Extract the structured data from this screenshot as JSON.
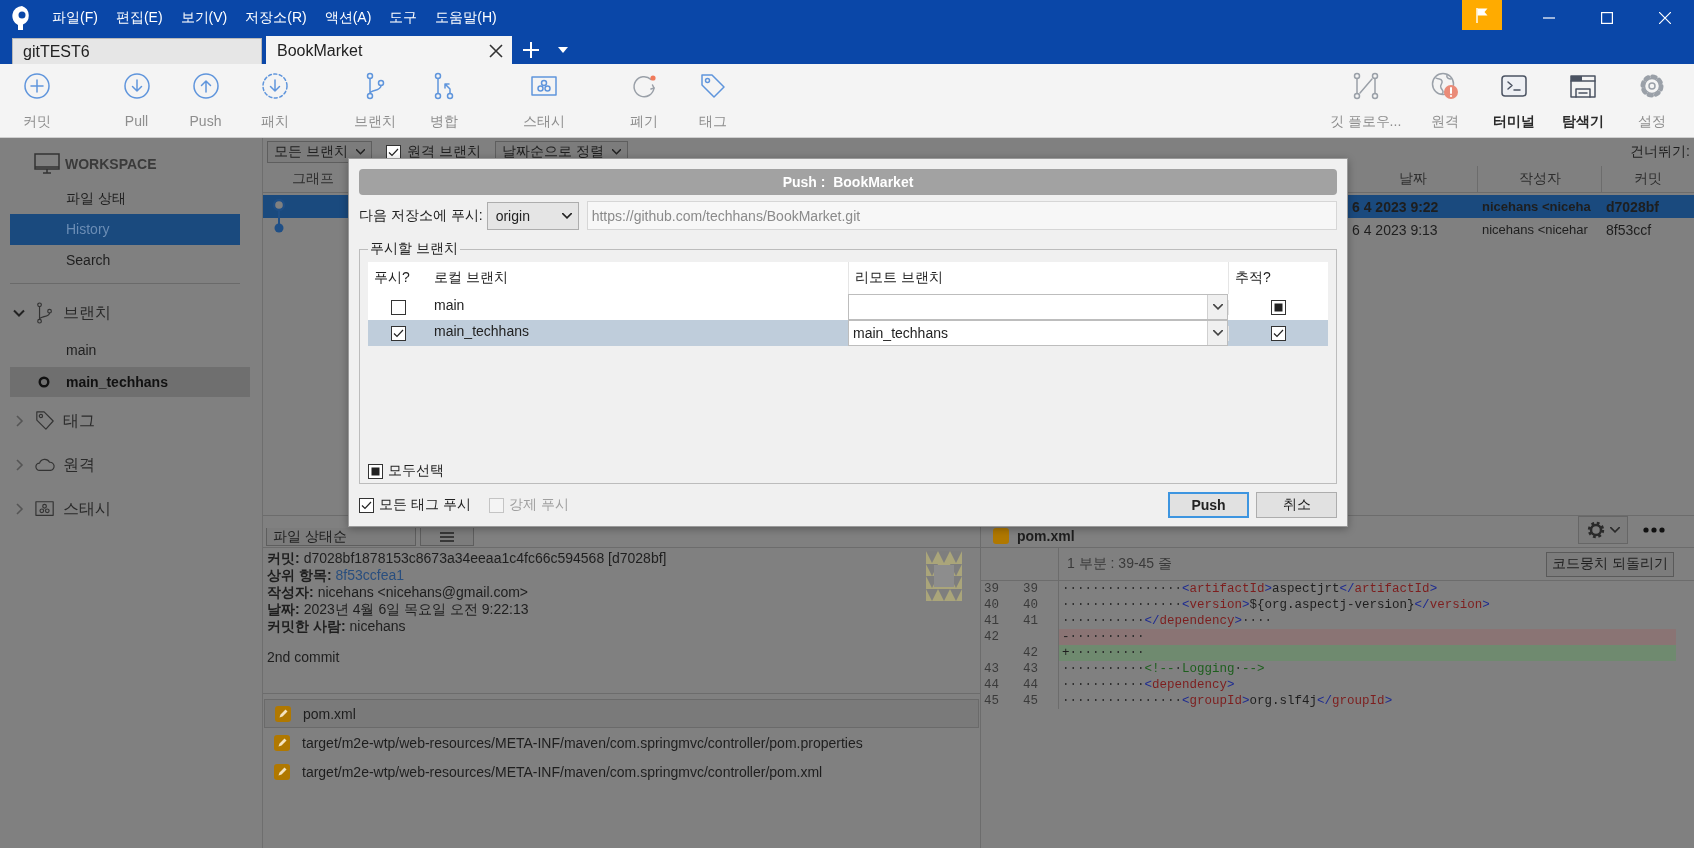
{
  "title_bar": {
    "menu": [
      "파일(F)",
      "편집(E)",
      "보기(V)",
      "저장소(R)",
      "액션(A)",
      "도구",
      "도움말(H)"
    ]
  },
  "tabs": [
    {
      "label": "gitTEST6",
      "selected": false
    },
    {
      "label": "BookMarket",
      "selected": true
    }
  ],
  "toolbar": {
    "left": [
      [
        {
          "label": "커밋",
          "strong": false
        }
      ],
      [
        {
          "label": "Pull",
          "strong": false
        },
        {
          "label": "Push",
          "strong": false
        },
        {
          "label": "패치",
          "strong": false
        }
      ],
      [
        {
          "label": "브랜치",
          "strong": false
        },
        {
          "label": "병합",
          "strong": false
        }
      ],
      [
        {
          "label": "스태시",
          "strong": false
        }
      ],
      [
        {
          "label": "폐기",
          "strong": false
        },
        {
          "label": "태그",
          "strong": false
        }
      ]
    ],
    "right": [
      [
        {
          "label": "깃 플로우...",
          "strong": false
        }
      ],
      [
        {
          "label": "원격",
          "strong": false
        },
        {
          "label": "터미널",
          "strong": true
        },
        {
          "label": "탐색기",
          "strong": true
        },
        {
          "label": "설정",
          "strong": false
        }
      ]
    ]
  },
  "sidebar": {
    "workspace": {
      "label": "WORKSPACE",
      "items": [
        {
          "label": "파일 상태",
          "selected": false
        },
        {
          "label": "History",
          "selected": true
        },
        {
          "label": "Search",
          "selected": false
        }
      ]
    },
    "sections": [
      {
        "label": "브랜치",
        "expanded": true,
        "children": [
          {
            "label": "main",
            "current": false
          },
          {
            "label": "main_techhans",
            "current": true
          }
        ]
      },
      {
        "label": "태그",
        "expanded": false
      },
      {
        "label": "원격",
        "expanded": false
      },
      {
        "label": "스태시",
        "expanded": false
      }
    ]
  },
  "history": {
    "filters": [
      {
        "kind": "dropdown",
        "label": "모든 브랜치"
      },
      {
        "kind": "checkbox",
        "label": "원격 브랜치",
        "checked": true
      },
      {
        "kind": "dropdown",
        "label": "날짜순으로 정렬"
      }
    ],
    "jump_label": "건너뛰기:",
    "columns": [
      "그래프",
      "날짜",
      "작성자",
      "커밋"
    ],
    "rows": [
      {
        "date": "6 4 2023 9:22",
        "author": "nicehans <niceha",
        "commit": "d7028bf",
        "selected": true
      },
      {
        "date": "6 4 2023 9:13",
        "author": "nicehans <nicehar",
        "commit": "8f53ccf",
        "selected": false
      }
    ]
  },
  "details": {
    "sort": "파일 상태순",
    "fields": [
      {
        "label": "커밋:",
        "value": "d7028bf1878153c8673a34eeaa1c4fc66c594568 [d7028bf]",
        "kind": "text"
      },
      {
        "label": "상위 항목:",
        "value": "8f53ccfea1",
        "kind": "link"
      },
      {
        "label": "작성자:",
        "value": "nicehans <nicehans@gmail.com>",
        "kind": "text"
      },
      {
        "label": "날짜:",
        "value": "2023년 4월 6일 목요일 오전 9:22:13",
        "kind": "text"
      },
      {
        "label": "커밋한 사람:",
        "value": "nicehans",
        "kind": "text"
      }
    ],
    "message": "2nd commit",
    "files": [
      {
        "path": "pom.xml",
        "selected": true
      },
      {
        "path": "target/m2e-wtp/web-resources/META-INF/maven/com.springmvc/controller/pom.properties",
        "selected": false
      },
      {
        "path": "target/m2e-wtp/web-resources/META-INF/maven/com.springmvc/controller/pom.xml",
        "selected": false
      }
    ]
  },
  "diff": {
    "file": "pom.xml",
    "hunk_title": "1 부분 : 39-45 줄",
    "revert_button": "코드뭉치 되돌리기",
    "lines": [
      {
        "old": "39",
        "new": "39",
        "kind": "context",
        "code": "················<artifactId>aspectjrt</artifactId>"
      },
      {
        "old": "40",
        "new": "40",
        "kind": "context",
        "code": "················<version>${org.aspectj-version}</version>"
      },
      {
        "old": "41",
        "new": "41",
        "kind": "context",
        "code": "···········</dependency>····"
      },
      {
        "old": "42",
        "kind": "removed",
        "code": "-··········"
      },
      {
        "new": "42",
        "kind": "added",
        "code": "+··········"
      },
      {
        "old": "43",
        "new": "43",
        "kind": "context",
        "code": "···········<!--·Logging·-->"
      },
      {
        "old": "44",
        "new": "44",
        "kind": "context",
        "code": "···········<dependency>"
      },
      {
        "old": "45",
        "new": "45",
        "kind": "context",
        "code": "················<groupId>org.slf4j</groupId>"
      }
    ]
  },
  "push_dialog": {
    "title": "Push :  BookMarket",
    "repo_label": "다음 저장소에 푸시:",
    "remote": "origin",
    "url": "https://github.com/techhans/BookMarket.git",
    "group_label": "푸시할 브랜치",
    "columns": [
      "푸시?",
      "로컬 브랜치",
      "리모트 브랜치",
      "추적?"
    ],
    "branches": [
      {
        "local": "main",
        "push": false,
        "tracked": false,
        "tracked_mixed": true,
        "selected": false
      },
      {
        "local": "main_techhans",
        "remote": "main_techhans",
        "push": true,
        "tracked": true,
        "tracked_mixed": false,
        "selected": true
      }
    ],
    "select_all": {
      "label": "모두선택",
      "checked": false,
      "mixed": true
    },
    "options": [
      {
        "label": "모든 태그 푸시",
        "checked": true,
        "disabled": false
      },
      {
        "label": "강제 푸시",
        "checked": false,
        "disabled": true
      }
    ],
    "buttons": [
      {
        "label": "Push",
        "default": true
      },
      {
        "label": "취소",
        "default": false
      }
    ]
  }
}
